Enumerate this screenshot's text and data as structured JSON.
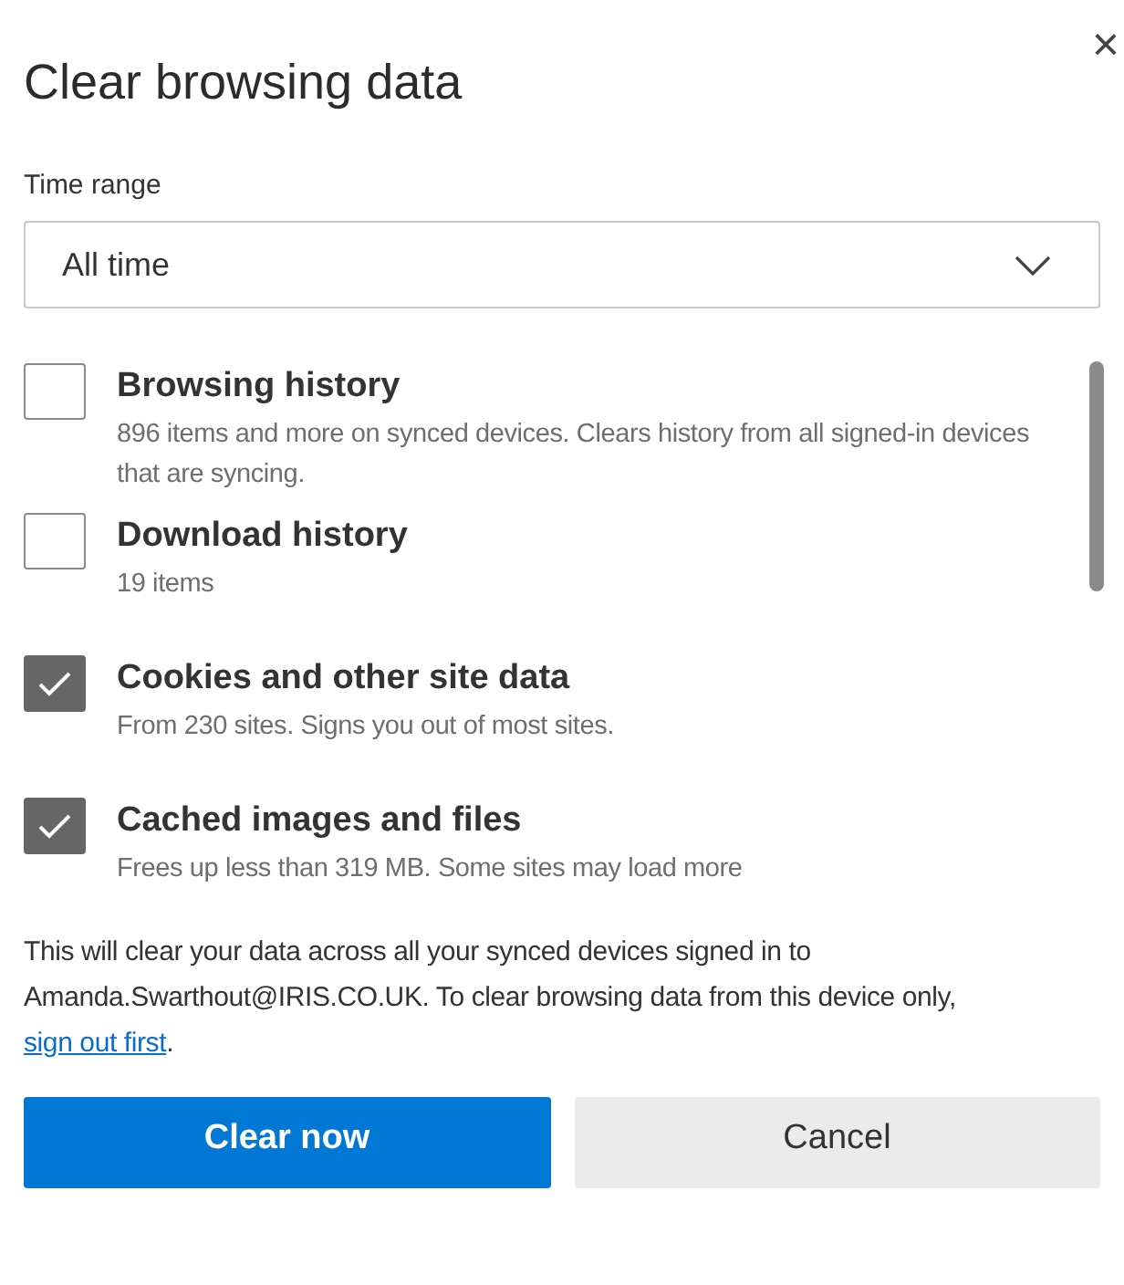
{
  "dialog": {
    "title": "Clear browsing data",
    "close": "×"
  },
  "time_range": {
    "label": "Time range",
    "value": "All time"
  },
  "options": [
    {
      "label": "Browsing history",
      "description": "896 items and more on synced devices. Clears history from all signed-in devices that are syncing.",
      "checked": false
    },
    {
      "label": "Download history",
      "description": "19 items",
      "checked": false
    },
    {
      "label": "Cookies and other site data",
      "description": "From 230 sites. Signs you out of most sites.",
      "checked": true
    },
    {
      "label": "Cached images and files",
      "description": "Frees up less than 319 MB. Some sites may load more",
      "checked": true
    }
  ],
  "notice": {
    "text": "This will clear your data across all your synced devices signed in to Amanda.Swarthout@IRIS.CO.UK. To clear browsing data from this device only, ",
    "link": "sign out first",
    "after": "."
  },
  "buttons": [
    {
      "label": "Clear now",
      "kind": "primary"
    },
    {
      "label": "Cancel",
      "kind": "secondary"
    }
  ]
}
